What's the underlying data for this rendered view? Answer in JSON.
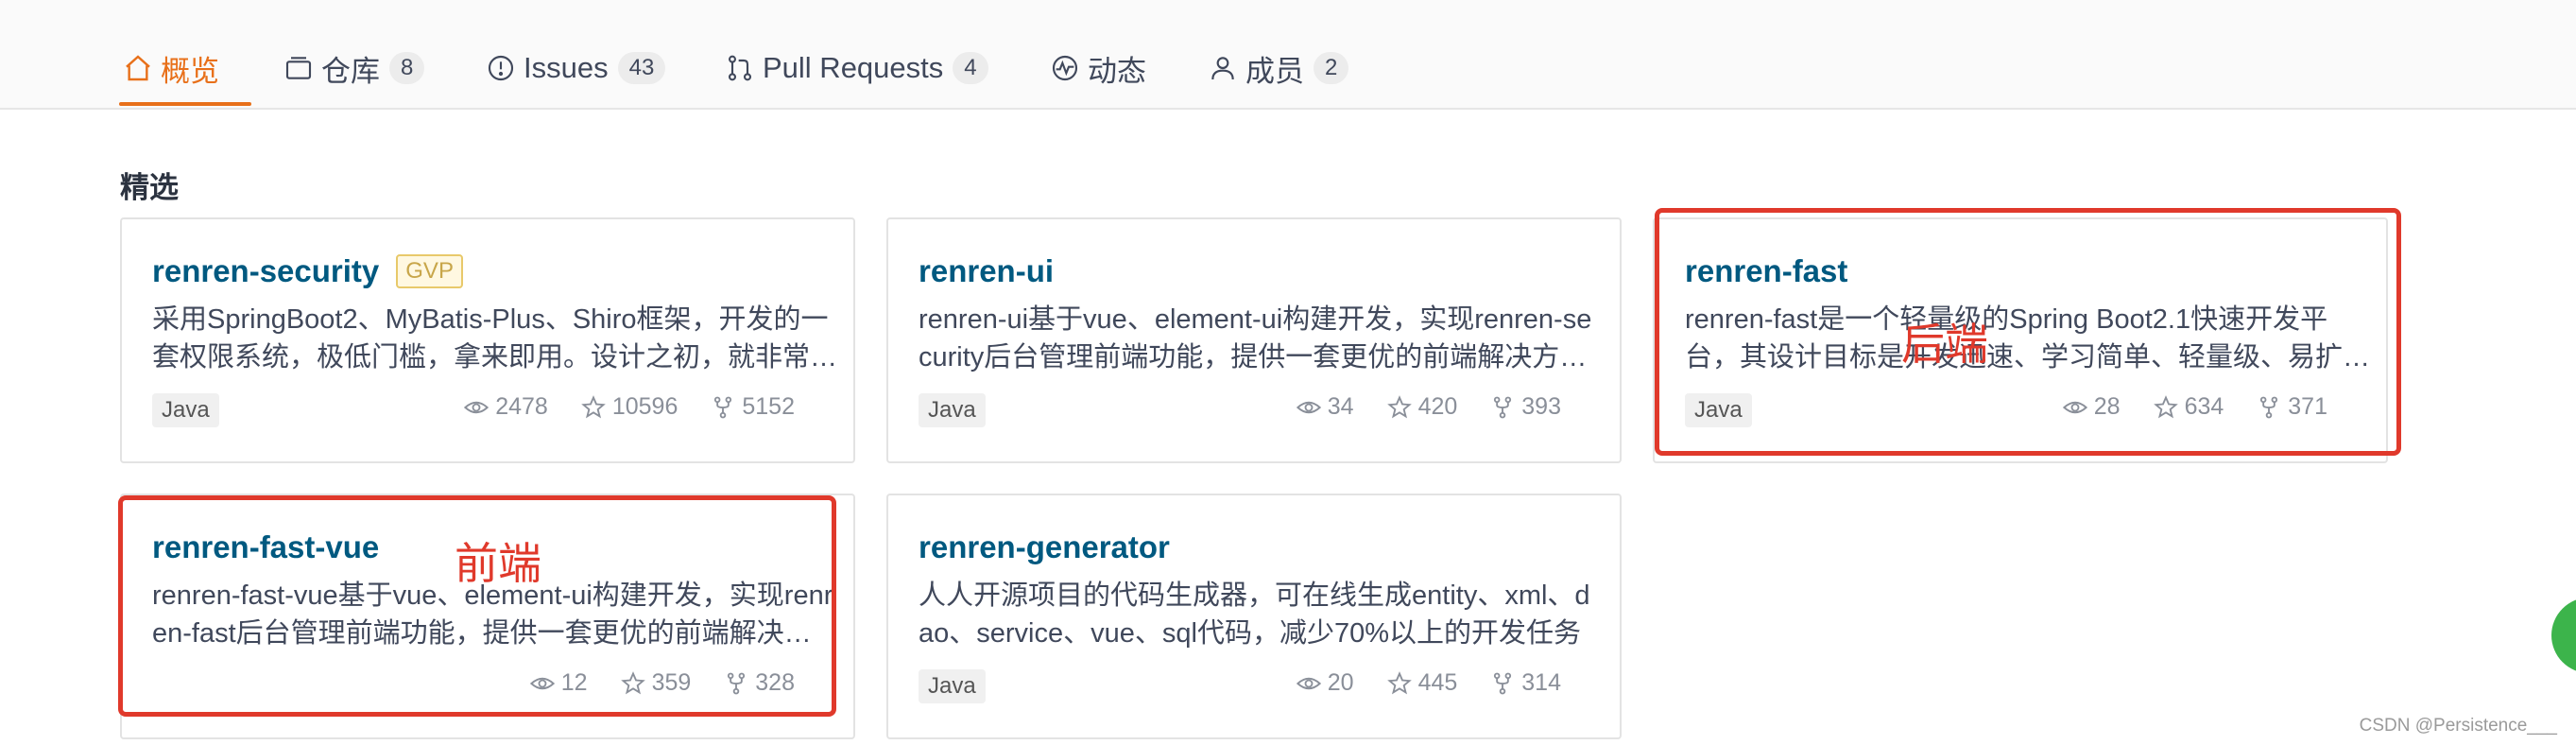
{
  "tabs": [
    {
      "label": "概览",
      "icon": "home-icon",
      "count": null,
      "active": true
    },
    {
      "label": "仓库",
      "icon": "repo-icon",
      "count": "8"
    },
    {
      "label": "Issues",
      "icon": "issue-icon",
      "count": "43"
    },
    {
      "label": "Pull Requests",
      "icon": "pull-request-icon",
      "count": "4"
    },
    {
      "label": "动态",
      "icon": "activity-icon",
      "count": null
    },
    {
      "label": "成员",
      "icon": "member-icon",
      "count": "2"
    }
  ],
  "section": {
    "title": "精选"
  },
  "cards": [
    {
      "name": "renren-security",
      "badge": "GVP",
      "desc": "采用SpringBoot2、MyBatis-Plus、Shiro框架，开发的一套权限系统，极低门槛，拿来即用。设计之初，就非常…",
      "lang": "Java",
      "watch": "2478",
      "star": "10596",
      "fork": "5152"
    },
    {
      "name": "renren-ui",
      "badge": null,
      "desc": "renren-ui基于vue、element-ui构建开发，实现renren-security后台管理前端功能，提供一套更优的前端解决方…",
      "lang": "Java",
      "watch": "34",
      "star": "420",
      "fork": "393"
    },
    {
      "name": "renren-fast",
      "badge": null,
      "desc": "renren-fast是一个轻量级的Spring Boot2.1快速开发平台，其设计目标是开发迅速、学习简单、轻量级、易扩…",
      "lang": "Java",
      "watch": "28",
      "star": "634",
      "fork": "371"
    },
    {
      "name": "renren-fast-vue",
      "badge": null,
      "desc": "renren-fast-vue基于vue、element-ui构建开发，实现renren-fast后台管理前端功能，提供一套更优的前端解决…",
      "lang": null,
      "watch": "12",
      "star": "359",
      "fork": "328"
    },
    {
      "name": "renren-generator",
      "badge": null,
      "desc": "人人开源项目的代码生成器，可在线生成entity、xml、dao、service、vue、sql代码，减少70%以上的开发任务",
      "lang": "Java",
      "watch": "20",
      "star": "445",
      "fork": "314"
    }
  ],
  "annotations": {
    "backend": "后端",
    "frontend": "前端",
    "color": "#e0392b"
  },
  "watermark": "CSDN @Persistence___",
  "colors": {
    "accent": "#e8701a",
    "repo_name": "#005980"
  }
}
